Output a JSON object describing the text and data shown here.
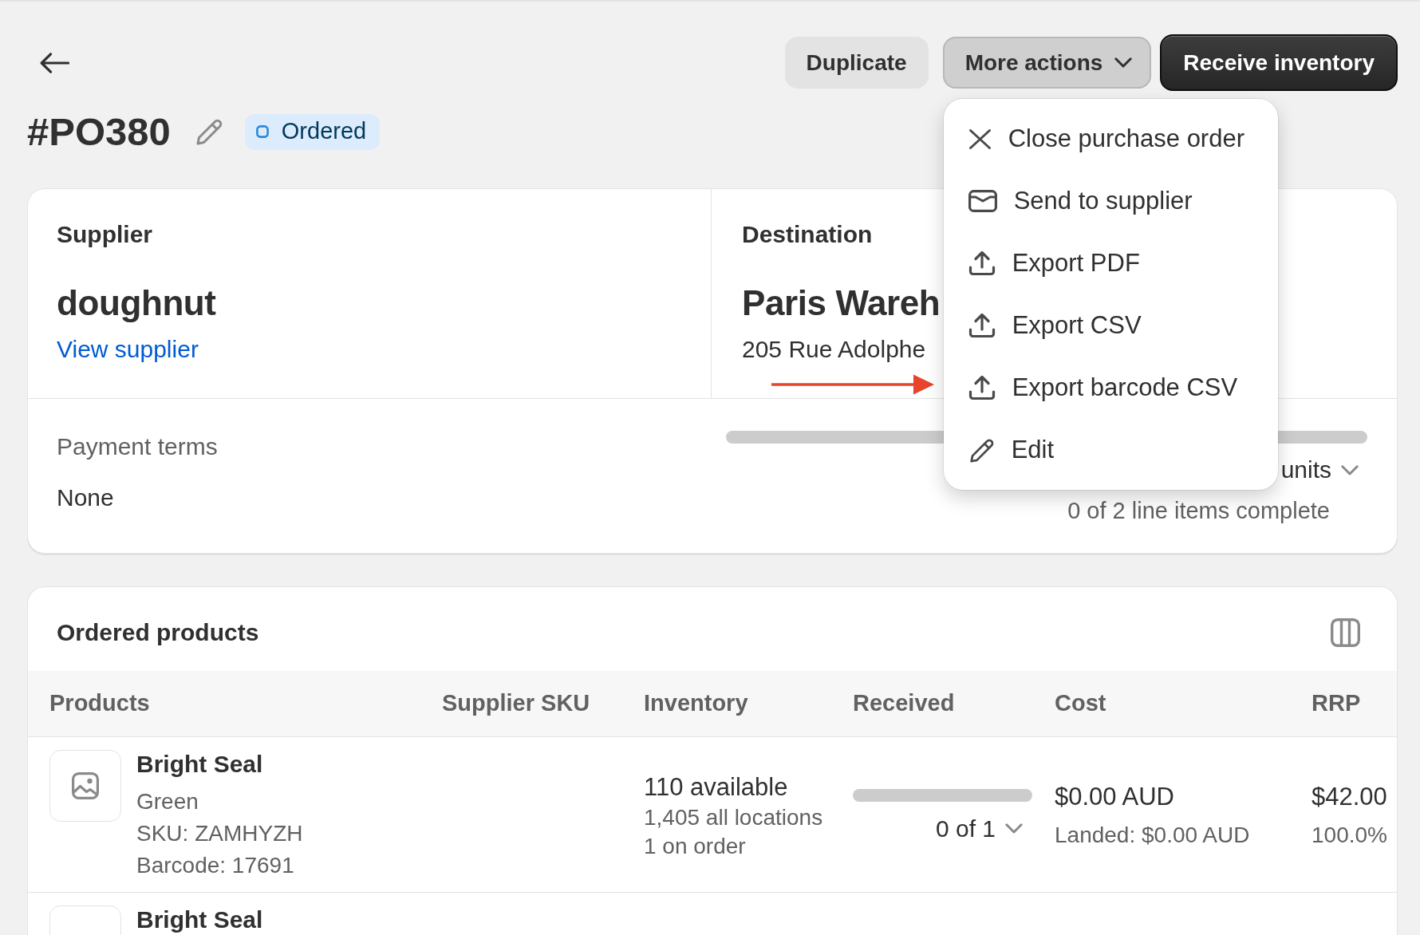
{
  "title": "#PO380",
  "status": {
    "label": "Ordered",
    "kind": "info"
  },
  "actions": [
    {
      "label": "Duplicate",
      "kind": "secondary"
    },
    {
      "label": "More actions",
      "kind": "menu",
      "expanded": true
    },
    {
      "label": "Receive inventory",
      "kind": "primary"
    }
  ],
  "action_menu": [
    {
      "label": "Close purchase order",
      "kind": "close"
    },
    {
      "label": "Send to supplier",
      "kind": "mail"
    },
    {
      "label": "Export PDF",
      "kind": "export"
    },
    {
      "label": "Export CSV",
      "kind": "export"
    },
    {
      "label": "Export barcode CSV",
      "kind": "export"
    },
    {
      "label": "Edit",
      "kind": "edit"
    }
  ],
  "annotation": {
    "kind": "arrow"
  },
  "summary": {
    "supplier": {
      "heading": "Supplier",
      "name": "doughnut",
      "link": "View supplier"
    },
    "destination": {
      "heading": "Destination",
      "name": "Paris Wareh",
      "address": "205 Rue Adolphe"
    },
    "payment_terms": {
      "label": "Payment terms",
      "value": "None"
    },
    "progress": {
      "level": 0,
      "units": "units",
      "items": "0 of 2 line items complete"
    }
  },
  "ordered_products": {
    "title": "Ordered products",
    "columns": [
      "Products",
      "Supplier SKU",
      "Inventory",
      "Received",
      "Cost",
      "RRP"
    ],
    "rows": [
      {
        "name": "Bright Seal",
        "thumbnail": {
          "kind": "placeholder"
        },
        "variant": "Green",
        "sku": "SKU: ZAMHYZH",
        "barcode": "Barcode: 17691",
        "available": "110 available",
        "all_locations": "1,405 all locations",
        "on_order": "1 on order",
        "received": {
          "level": 0,
          "label": "0 of 1"
        },
        "cost": "$0.00 AUD",
        "landed_cost": "Landed: $0.00 AUD",
        "rrp": "$42.00",
        "rrp_detail": "100.0%"
      },
      {
        "name": "Bright Seal"
      }
    ]
  }
}
